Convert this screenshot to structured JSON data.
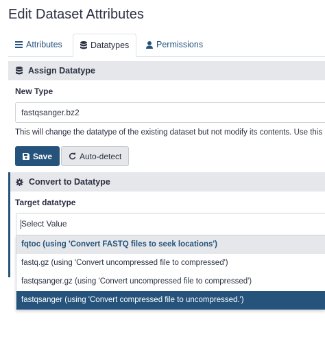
{
  "page": {
    "title": "Edit Dataset Attributes"
  },
  "tabs": [
    {
      "label": "Attributes",
      "icon": "list-icon",
      "active": false
    },
    {
      "label": "Datatypes",
      "icon": "database-icon",
      "active": true
    },
    {
      "label": "Permissions",
      "icon": "user-icon",
      "active": false
    }
  ],
  "assign": {
    "header": "Assign Datatype",
    "new_type_label": "New Type",
    "new_type_value": "fastqsanger.bz2",
    "help": "This will change the datatype of the existing dataset but not modify its contents. Use this",
    "save_label": "Save",
    "autodetect_label": "Auto-detect"
  },
  "convert": {
    "header": "Convert to Datatype",
    "target_label": "Target datatype",
    "select_placeholder": "Select Value",
    "options": [
      {
        "label": "fqtoc (using 'Convert FASTQ files to seek locations')",
        "state": "group"
      },
      {
        "label": "fastq.gz (using 'Convert uncompressed file to compressed')",
        "state": "normal"
      },
      {
        "label": "fastqsanger.gz (using 'Convert uncompressed file to compressed')",
        "state": "normal"
      },
      {
        "label": "fastqsanger (using 'Convert compressed file to uncompressed.')",
        "state": "selected"
      }
    ]
  },
  "colors": {
    "primary": "#25537b",
    "header_bg": "#e5e7ea",
    "text": "#2c3143"
  }
}
